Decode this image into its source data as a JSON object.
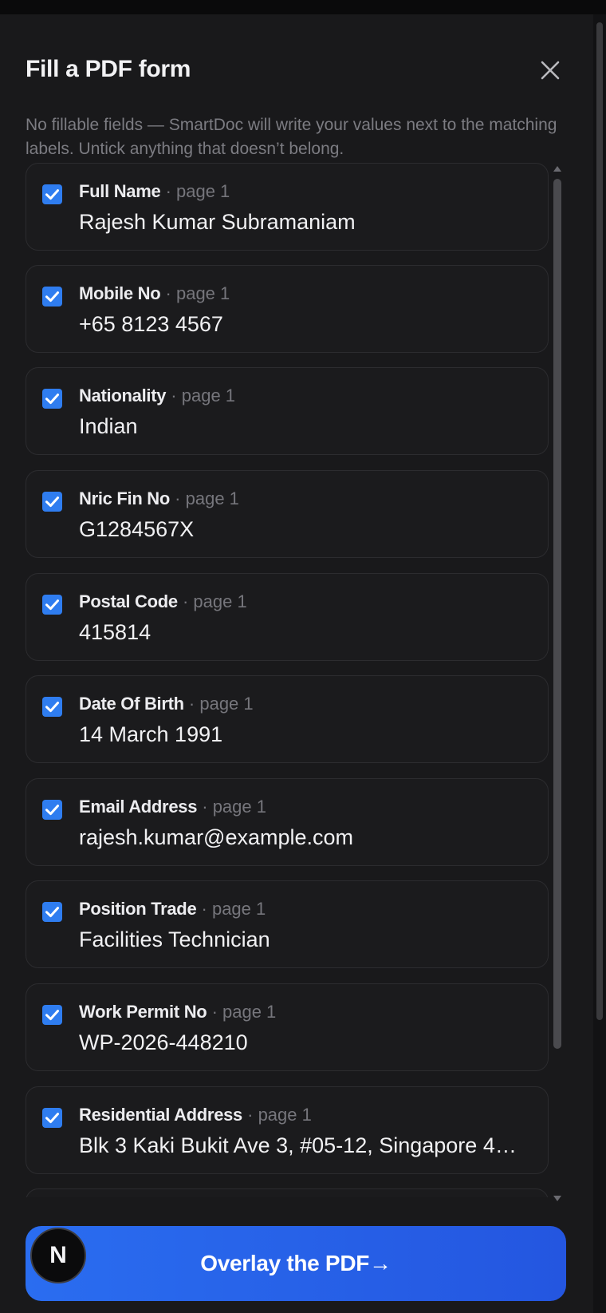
{
  "dialog": {
    "title": "Fill a PDF form",
    "subtitle": "No fillable fields — SmartDoc will write your values next to the matching labels. Untick anything that doesn’t belong."
  },
  "fields": [
    {
      "label": "Full Name",
      "page": "· page 1",
      "value": "Rajesh Kumar Subramaniam",
      "checked": true
    },
    {
      "label": "Mobile No",
      "page": "· page 1",
      "value": "+65 8123 4567",
      "checked": true
    },
    {
      "label": "Nationality",
      "page": "· page 1",
      "value": "Indian",
      "checked": true
    },
    {
      "label": "Nric Fin No",
      "page": "· page 1",
      "value": "G1284567X",
      "checked": true
    },
    {
      "label": "Postal Code",
      "page": "· page 1",
      "value": "415814",
      "checked": true
    },
    {
      "label": "Date Of Birth",
      "page": "· page 1",
      "value": "14 March 1991",
      "checked": true
    },
    {
      "label": "Email Address",
      "page": "· page 1",
      "value": "rajesh.kumar@example.com",
      "checked": true
    },
    {
      "label": "Position Trade",
      "page": "· page 1",
      "value": "Facilities Technician",
      "checked": true
    },
    {
      "label": "Work Permit No",
      "page": "· page 1",
      "value": "WP-2026-448210",
      "checked": true
    },
    {
      "label": "Residential Address",
      "page": "· page 1",
      "value": "Blk 3 Kaki Bukit Ave 3, #05-12, Singapore 4…",
      "checked": true
    }
  ],
  "actions": {
    "overlay_label": "Overlay the PDF→"
  },
  "avatar": {
    "letter": "N"
  },
  "colors": {
    "accent": "#2f7df0",
    "button": "#2a6df0",
    "panel": "#19191b"
  }
}
